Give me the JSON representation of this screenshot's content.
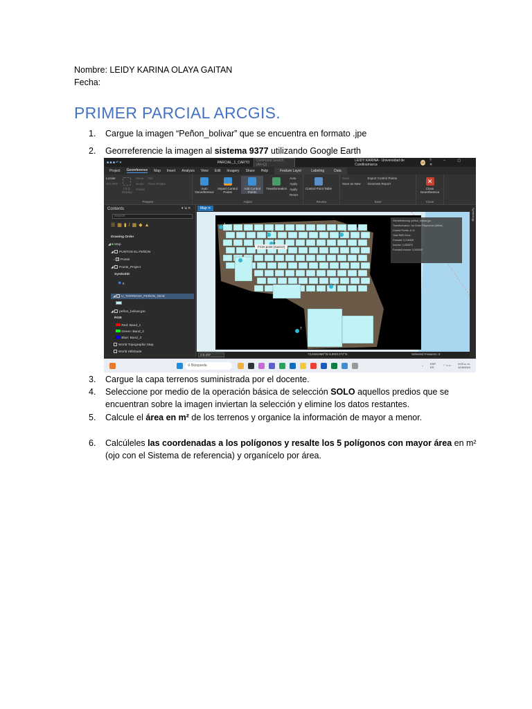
{
  "header": {
    "nombre": "Nombre: LEIDY KARINA OLAYA GAITAN",
    "fecha": "Fecha:"
  },
  "title": "PRIMER PARCIAL ARCGIS.",
  "items": [
    {
      "num": "1.",
      "pre": "Cargue la imagen “Peñon_bolivar” que se encuentra en formato .jpe",
      "bold": "",
      "post": ""
    },
    {
      "num": "2.",
      "pre": "Georreferencie la imagen al ",
      "bold": "sistema 9377",
      "post": " utilizando Google Earth"
    },
    {
      "num": "3.",
      "pre": "Cargue la capa terrenos suministrada por el docente.",
      "bold": "",
      "post": ""
    },
    {
      "num": "4.",
      "pre": "Seleccione por medio de la operación básica de selección ",
      "bold": "SOLO",
      "post": " aquellos predios que se",
      "line2": "encuentran sobre la imagen inviertan la selección y elimine los datos restantes."
    },
    {
      "num": "5.",
      "pre": "Calcule el ",
      "bold": "área en m²",
      "post": " de los terrenos y organice la información de mayor a menor."
    },
    {
      "num": "6.",
      "pre": "Calcúleles ",
      "bold": "las coordenadas a los polígonos y resalte los 5 polígonos con mayor área",
      "post": " en m²",
      "line2": "(ojo con el Sistema de referencia) y organícelo por área."
    }
  ],
  "app": {
    "project": "PARCIAL_1_CARTO",
    "search_placeholder": "Command Search (Alt+Q)",
    "user": "LEIDY KARINA - Universidad de Cundinamarca",
    "avatar": "LK",
    "tabs": [
      "Project",
      "Georeference",
      "Map",
      "Insert",
      "Analysis",
      "View",
      "Edit",
      "Imagery",
      "Share",
      "Help"
    ],
    "context_tabs": [
      "Feature Layer",
      "Labeling",
      "Data"
    ],
    "ribbon": {
      "prepare": {
        "label": "Prepare",
        "locate": "Locate",
        "set_srs": "Set SRS",
        "fit": "Fit to Display",
        "move": "Move",
        "scale": "Scale",
        "rotate": "Rotate",
        "flip": "Flip",
        "fixed_rotate": "Fixed Rotate"
      },
      "adjust": {
        "label": "Adjust",
        "auto_geo": "Auto Georeference",
        "import_cp": "Import Control Points",
        "add_cp": "Add Control Points",
        "transformation": "Transformation",
        "auto_apply": "Auto Apply",
        "apply": "Apply",
        "reset": "Reset"
      },
      "review": {
        "label": "Review",
        "cp_table": "Control Point Table"
      },
      "save": {
        "label": "Save",
        "save": "Save",
        "save_new": "Save as New",
        "export_cp": "Export Control Points",
        "report": "Generate Report"
      },
      "close": {
        "label": "Close",
        "close_geo": "Close Georeference"
      }
    },
    "contents": {
      "title": "Contents",
      "search": "Search",
      "drawing_order": "Drawing Order",
      "layers": [
        "Map",
        "PUNTOS EL PEÑON",
        "Points",
        "Points_Project",
        "SymbolID",
        "0",
        "U_TERRENO_PEÑON_MCB",
        "peñon_bolivar.jpe",
        "RGB",
        "Red: Band_1",
        "Green: Band_2",
        "Blue: Band_3",
        "World Topographic Map",
        "World Hillshade"
      ]
    },
    "map_tab": "Map",
    "tooltip": "From point (source)",
    "georef_panel": {
      "title": "Georeferencing: peñon_bolivar.jpe",
      "lines": [
        "Transformation: 1st Order Polynomial (Affine)",
        "Control Points: 8 / 8",
        "Total RMS Error:",
        "Forward: 0,218408",
        "Inverse: 2,280670",
        "Forward-Inverse: 0,000000"
      ]
    },
    "pins": [
      "1",
      "2",
      "3",
      "4",
      "5",
      "6",
      "7"
    ],
    "scale": "1:5.437",
    "coords": "73,9481966°W 8,9001272°N",
    "selected": "Selected Features: 8",
    "sidebar": "Symbology",
    "taskbar": {
      "search": "Búsqueda",
      "lang": "ESP",
      "lang2": "ES",
      "time": "9:03 a. m.",
      "date": "3/18/2024"
    }
  },
  "colors": {
    "accent": "#4472c4",
    "parcel": "#bff3f6",
    "pin": "#2fb7d6"
  }
}
